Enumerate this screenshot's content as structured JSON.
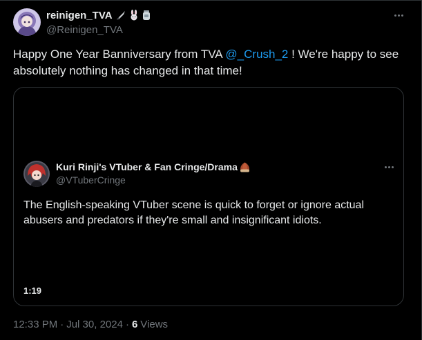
{
  "author": {
    "display_name": "reinigen_TVA",
    "handle": "@Reinigen_TVA",
    "emoji_icons": [
      "knife-icon",
      "rabbit-icon",
      "jar-icon"
    ]
  },
  "tweet": {
    "text_before": "Happy One Year Banniversary from TVA ",
    "mention": "@_Crush_2",
    "text_after": " ! We're happy to see absolutely nothing has changed in that time!"
  },
  "quote": {
    "display_name": "Kuri Rinji's VTuber & Fan Cringe/Drama",
    "emoji_icon": "chestnut-icon",
    "handle": "@VTuberCringe",
    "text": "The English-speaking VTuber scene is quick to forget or ignore actual abusers and predators if they're small and insignificant idiots.",
    "video_duration": "1:19"
  },
  "meta": {
    "time": "12:33 PM",
    "separator": "·",
    "date": "Jul 30, 2024",
    "views_count": "6",
    "views_label": "Views"
  },
  "colors": {
    "background": "#000000",
    "text": "#e7e9ea",
    "muted": "#71767b",
    "accent": "#1d9bf0",
    "border": "#2f3336"
  }
}
